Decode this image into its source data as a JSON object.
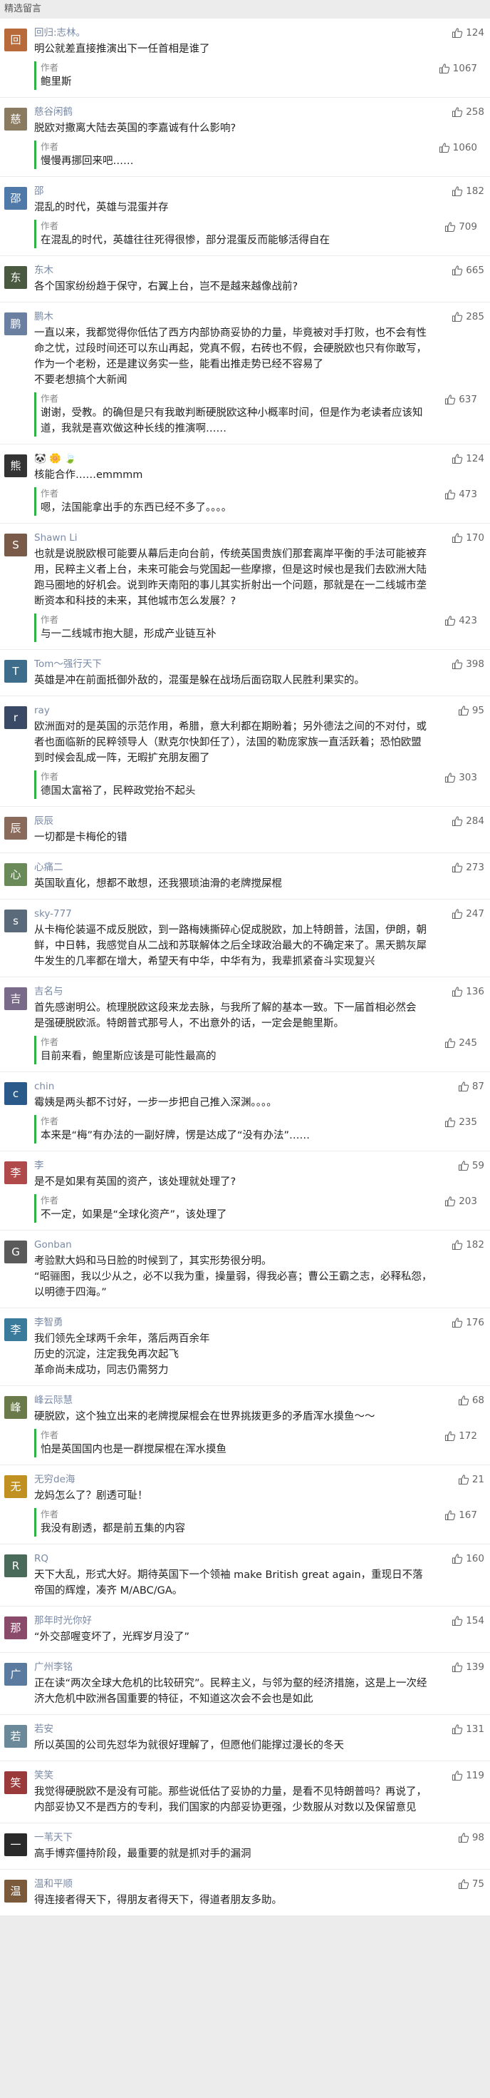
{
  "section_title": "精选留言",
  "reply_label": "作者",
  "comments": [
    {
      "nick": "回归:志林。",
      "avatar": "回",
      "avatar_color": "#b86a3a",
      "likes": "124",
      "lines": [
        "明公就差直接推演出下一任首相是谁了"
      ],
      "reply": {
        "likes": "1067",
        "lines": [
          "鲍里斯"
        ]
      }
    },
    {
      "nick": "慈谷闲鹤",
      "avatar": "慈",
      "avatar_color": "#8a7a60",
      "likes": "258",
      "lines": [
        "脱欧对撒离大陆去英国的李嘉诚有什么影响?"
      ],
      "reply": {
        "likes": "1060",
        "lines": [
          "慢慢再挪回来吧……"
        ]
      }
    },
    {
      "nick": "邵",
      "avatar": "邵",
      "avatar_color": "#4f79a8",
      "likes": "182",
      "lines": [
        "混乱的时代，英雄与混蛋并存"
      ],
      "reply": {
        "likes": "709",
        "lines": [
          "在混乱的时代，英雄往往死得很惨，部分混蛋反而能够活得自在"
        ]
      }
    },
    {
      "nick": "东木",
      "avatar": "东",
      "avatar_color": "#4a5a40",
      "likes": "665",
      "lines": [
        "各个国家纷纷趋于保守，右翼上台，岂不是越来越像战前?"
      ],
      "reply": null
    },
    {
      "nick": "鹏木",
      "avatar": "鹏",
      "avatar_color": "#6b7fa0",
      "likes": "285",
      "lines": [
        "一直以来，我都觉得你低估了西方内部协商妥协的力量，毕竟被对手打败，也不会有性",
        "命之忧，过段时间还可以东山再起，党真不假，右砖也不假，会硬脱欧也只有你敢写，",
        "  作为一个老粉，还是建议务实一些，能看出推走势已经不容易了",
        "  不要老想搞个大新闻"
      ],
      "reply": {
        "likes": "637",
        "lines": [
          "谢谢，受教。的确但是只有我敢判断硬脱欧这种小概率时间，但是作为老读者应该知",
          "道，我就是喜欢做这种长线的推演啊……"
        ]
      }
    },
    {
      "nick": "🐼 🌼 🍃",
      "avatar": "熊",
      "avatar_color": "#333333",
      "likes": "124",
      "lines": [
        "核能合作……emmmm"
      ],
      "reply": {
        "likes": "473",
        "lines": [
          "嗯，法国能拿出手的东西已经不多了。。。。"
        ]
      }
    },
    {
      "nick": "Shawn Li",
      "avatar": "S",
      "avatar_color": "#7a5a48",
      "likes": "170",
      "lines": [
        "也就是说脱欧根可能要从幕后走向台前，传统英国贵族们那套离岸平衡的手法可能被弃",
        "用，民粹主义者上台，未来可能会与党国起一些摩擦，但是这时候也是我们去欧洲大陆",
        "跑马圈地的好机会。说到昨天南阳的事儿其实折射出一个问题，那就是在一二线城市垄",
        "断资本和科技的未来，其他城市怎么发展？?"
      ],
      "reply": {
        "likes": "423",
        "lines": [
          "与一二线城市抱大腿，形成产业链互补"
        ]
      }
    },
    {
      "nick": "Tom～强行天下",
      "avatar": "T",
      "avatar_color": "#3d6d8a",
      "likes": "398",
      "lines": [
        "英雄是冲在前面抵御外敌的，混蛋是躲在战场后面窃取人民胜利果实的。"
      ],
      "reply": null
    },
    {
      "nick": "ray",
      "avatar": "r",
      "avatar_color": "#3a4a66",
      "likes": "95",
      "lines": [
        "欧洲面对的是英国的示范作用，希腊，意大利都在期盼着；另外德法之间的不对付，或",
        "者也面临新的民粹领导人（默克尔快卸任了），法国的勒庞家族一直活跃着；恐怕欧盟",
        "到时候会乱成一阵，无暇扩充朋友圈了"
      ],
      "reply": {
        "likes": "303",
        "lines": [
          "德国太富裕了，民粹政党抬不起头"
        ]
      }
    },
    {
      "nick": "辰辰",
      "avatar": "辰",
      "avatar_color": "#8a6a5a",
      "likes": "284",
      "lines": [
        "一切都是卡梅伦的错"
      ],
      "reply": null
    },
    {
      "nick": "心痛二",
      "avatar": "心",
      "avatar_color": "#6a8a5a",
      "likes": "273",
      "lines": [
        "英国耿直化，想都不敢想，还我猥琐油滑的老牌搅屎棍"
      ],
      "reply": null
    },
    {
      "nick": "sky-777",
      "avatar": "s",
      "avatar_color": "#5a6a7a",
      "likes": "247",
      "lines": [
        "从卡梅伦装逼不成反脱欧，到一路梅姨撕碎心促成脱欧，加上特朗普，法国，伊朗，朝",
        "鲜，中日韩，我感觉自从二战和苏联解体之后全球政治最大的不确定来了。黑天鹅灰犀",
        "牛发生的几率都在增大，希望天有中华，中华有为，我辈抓紧奋斗实现复兴"
      ],
      "reply": null
    },
    {
      "nick": "吉名与",
      "avatar": "吉",
      "avatar_color": "#7a6a8a",
      "likes": "136",
      "lines": [
        "首先感谢明公。梳理脱欧这段来龙去脉，与我所了解的基本一致。下一届首相必然会",
        "是强硬脱欧派。特朗普式那号人，不出意外的话，一定会是鲍里斯。"
      ],
      "reply": {
        "likes": "245",
        "lines": [
          "目前来看，鲍里斯应该是可能性最高的"
        ]
      }
    },
    {
      "nick": "chin",
      "avatar": "c",
      "avatar_color": "#2a5a8a",
      "likes": "87",
      "lines": [
        "霉姨是两头都不讨好，一步一步把自己推入深渊。。。。"
      ],
      "reply": {
        "likes": "235",
        "lines": [
          "本来是“梅”有办法的一副好牌，愣是达成了“没有办法”……"
        ]
      }
    },
    {
      "nick": "李",
      "avatar": "李",
      "avatar_color": "#b04a4a",
      "likes": "59",
      "lines": [
        "是不是如果有英国的资产，该处理就处理了?"
      ],
      "reply": {
        "likes": "203",
        "lines": [
          "不一定，如果是“全球化资产”，该处理了"
        ]
      }
    },
    {
      "nick": "Gonban",
      "avatar": "G",
      "avatar_color": "#5a5a5a",
      "likes": "182",
      "lines": [
        "考验默大妈和马日脸的时候到了，其实形势很分明。",
        "“昭骊图，我以少从之，必不以我为重，操量弱，得我必喜；曹公王霸之志，必释私怨，",
        "以明德于四海。”"
      ],
      "reply": null
    },
    {
      "nick": "李智勇",
      "avatar": "李",
      "avatar_color": "#3a7a9a",
      "likes": "176",
      "lines": [
        "我们领先全球两千余年，落后两百余年",
        "历史的沉淀，注定我免再次起飞",
        "革命尚未成功，同志仍需努力"
      ],
      "reply": null
    },
    {
      "nick": "峰云际慧",
      "avatar": "峰",
      "avatar_color": "#6a7a4a",
      "likes": "68",
      "lines": [
        "硬脱欧，这个独立出来的老牌搅屎棍会在世界挑拨更多的矛盾浑水摸鱼～～"
      ],
      "reply": {
        "likes": "172",
        "lines": [
          "怕是英国国内也是一群搅屎棍在浑水摸鱼"
        ]
      }
    },
    {
      "nick": "无穷de海",
      "avatar": "无",
      "avatar_color": "#c09020",
      "likes": "21",
      "lines": [
        "龙妈怎么了？剧透可耻！"
      ],
      "reply": {
        "likes": "167",
        "lines": [
          "我没有剧透，都是前五集的内容"
        ]
      }
    },
    {
      "nick": "RQ",
      "avatar": "R",
      "avatar_color": "#4a6a5a",
      "likes": "160",
      "lines": [
        "天下大乱，形式大好。期待英国下一个领袖 make British great again，重现日不落",
        "帝国的辉煌，凑齐 M/ABC/GA。"
      ],
      "reply": null
    },
    {
      "nick": "那年时光你好",
      "avatar": "那",
      "avatar_color": "#8a4a6a",
      "likes": "154",
      "lines": [
        "“外交部喔变坏了，光辉岁月没了”"
      ],
      "reply": null
    },
    {
      "nick": "广州李铭",
      "avatar": "广",
      "avatar_color": "#5a7aa0",
      "likes": "139",
      "lines": [
        "正在读“两次全球大危机的比较研究”。民粹主义，与邻为壑的经济措施，这是上一次经",
        "济大危机中欧洲各国重要的特征，不知道这次会不会也是如此"
      ],
      "reply": null
    },
    {
      "nick": "若安",
      "avatar": "若",
      "avatar_color": "#6a8a9a",
      "likes": "131",
      "lines": [
        "所以英国的公司先怼华为就很好理解了，但愿他们能撑过漫长的冬天"
      ],
      "reply": null
    },
    {
      "nick": "笑笑",
      "avatar": "笑",
      "avatar_color": "#9a3a3a",
      "likes": "119",
      "lines": [
        "我觉得硬脱欧不是没有可能。那些说低估了妥协的力量，是看不见特朗普吗？再说了，",
        "内部妥协又不是西方的专利，我们国家的内部妥协更强，少数服从对数以及保留意见"
      ],
      "reply": null
    },
    {
      "nick": "一苇天下",
      "avatar": "一",
      "avatar_color": "#2a2a2a",
      "likes": "98",
      "lines": [
        "高手博弈僵持阶段，最重要的就是抓对手的漏洞"
      ],
      "reply": null
    },
    {
      "nick": "温和平顺",
      "avatar": "温",
      "avatar_color": "#7a5a3a",
      "likes": "75",
      "lines": [
        "得连接者得天下，得朋友者得天下，得道者朋友多助。"
      ],
      "reply": null
    }
  ]
}
